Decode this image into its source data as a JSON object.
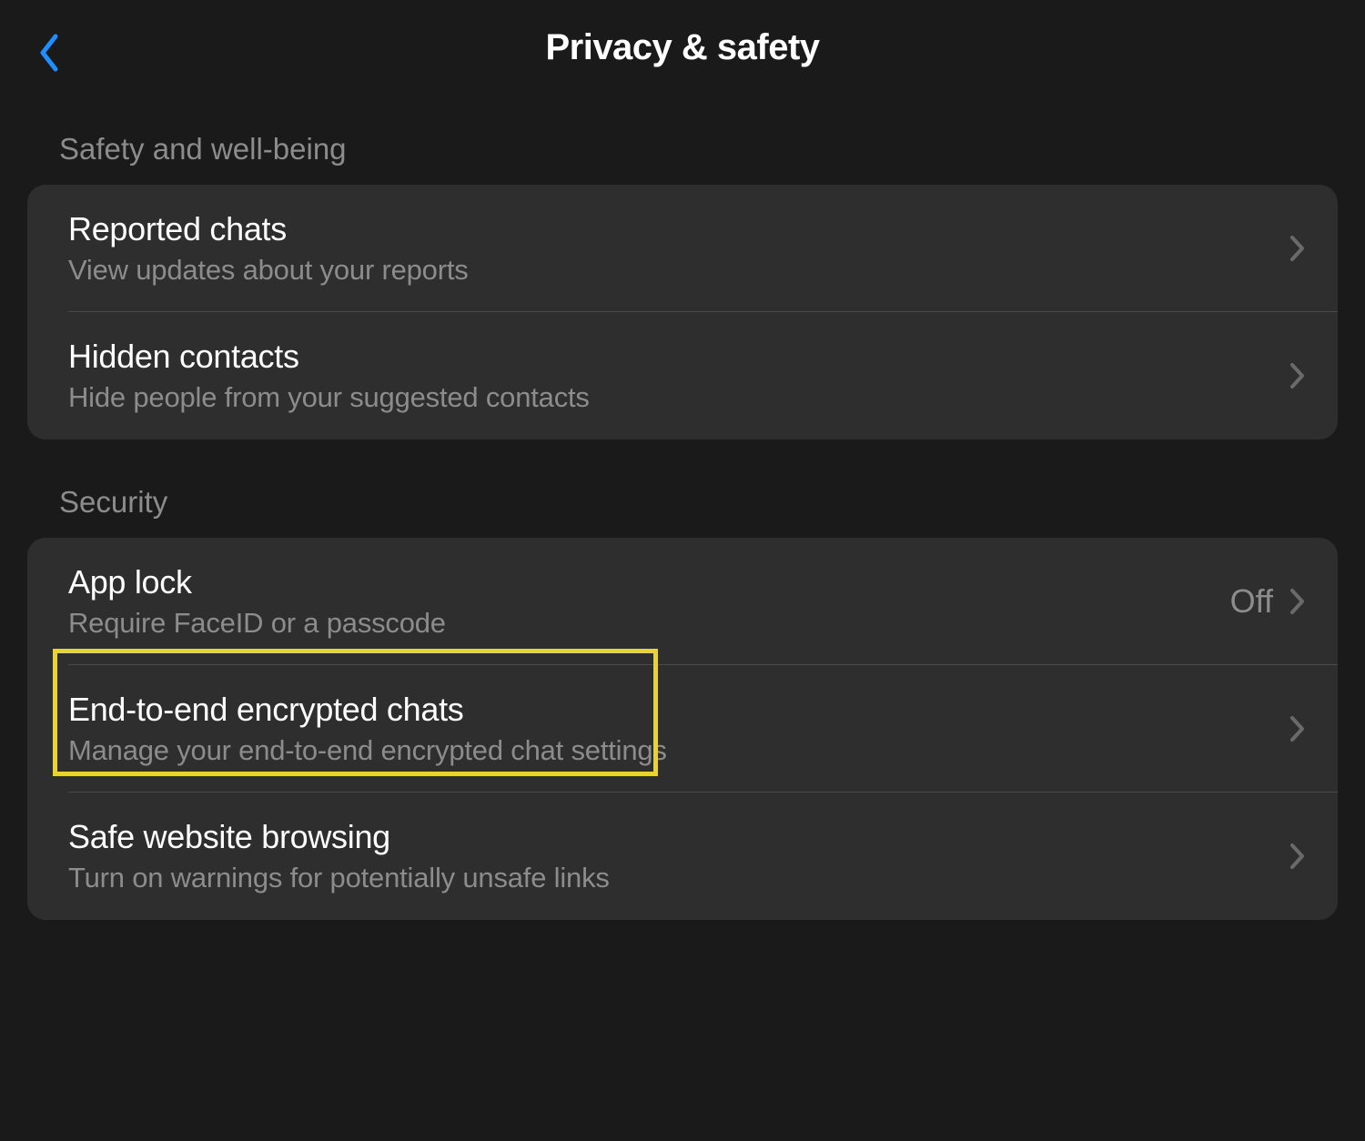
{
  "header": {
    "title": "Privacy & safety"
  },
  "sections": {
    "safety": {
      "header": "Safety and well-being",
      "items": [
        {
          "title": "Reported chats",
          "subtitle": "View updates about your reports"
        },
        {
          "title": "Hidden contacts",
          "subtitle": "Hide people from your suggested contacts"
        }
      ]
    },
    "security": {
      "header": "Security",
      "items": [
        {
          "title": "App lock",
          "subtitle": "Require FaceID or a passcode",
          "value": "Off"
        },
        {
          "title": "End-to-end encrypted chats",
          "subtitle": "Manage your end-to-end encrypted chat settings"
        },
        {
          "title": "Safe website browsing",
          "subtitle": "Turn on warnings for potentially unsafe links"
        }
      ]
    }
  }
}
